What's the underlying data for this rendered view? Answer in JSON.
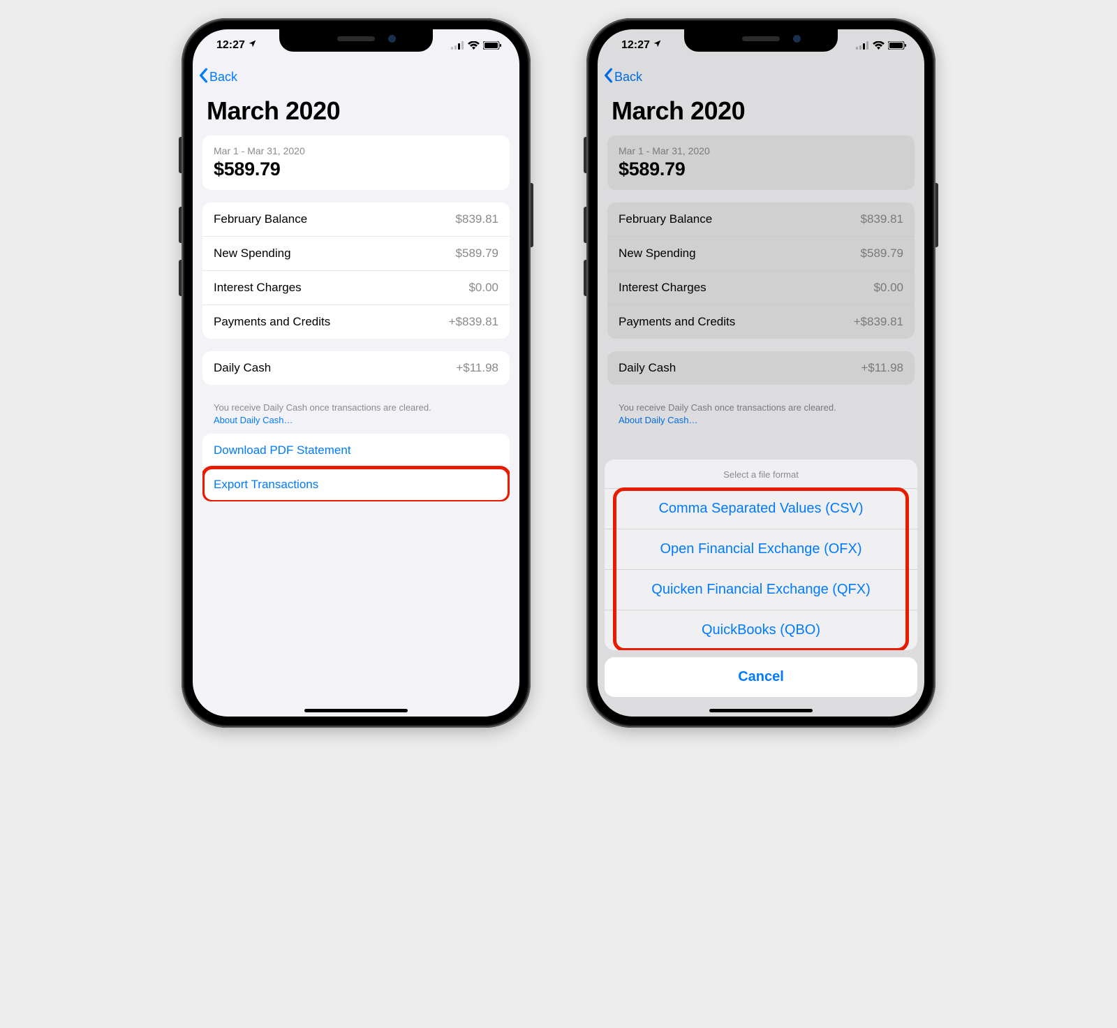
{
  "status": {
    "time": "12:27",
    "location_icon": "location-icon"
  },
  "nav": {
    "back_label": "Back"
  },
  "page": {
    "title": "March 2020",
    "date_range": "Mar 1 - Mar 31, 2020",
    "total": "$589.79"
  },
  "balance_rows": [
    {
      "label": "February Balance",
      "value": "$839.81"
    },
    {
      "label": "New Spending",
      "value": "$589.79"
    },
    {
      "label": "Interest Charges",
      "value": "$0.00"
    },
    {
      "label": "Payments and Credits",
      "value": "+$839.81"
    }
  ],
  "daily_cash": {
    "label": "Daily Cash",
    "value": "+$11.98",
    "note": "You receive Daily Cash once transactions are cleared.",
    "link": "About Daily Cash…"
  },
  "actions": {
    "download_pdf": "Download PDF Statement",
    "export": "Export Transactions"
  },
  "sheet": {
    "title": "Select a file format",
    "options": [
      "Comma Separated Values (CSV)",
      "Open Financial Exchange (OFX)",
      "Quicken Financial Exchange (QFX)",
      "QuickBooks (QBO)"
    ],
    "cancel": "Cancel"
  }
}
